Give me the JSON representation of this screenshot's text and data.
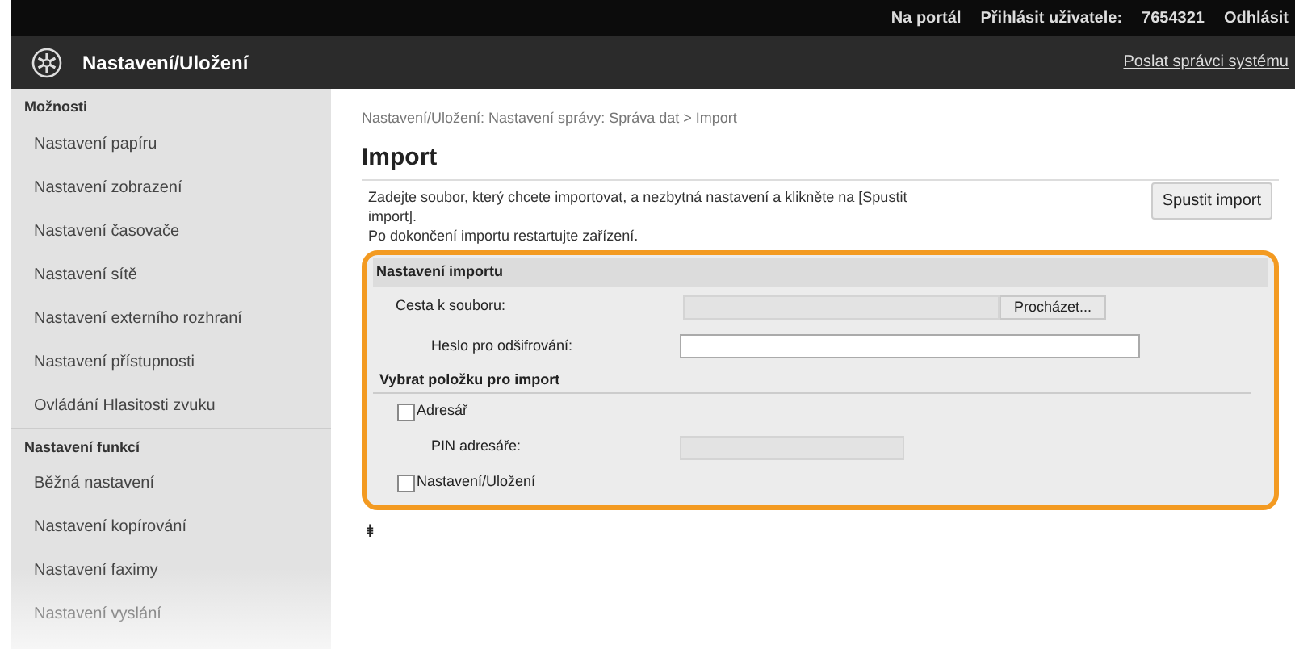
{
  "top_bar": {
    "links": [
      "Na portál",
      "Přihlásit uživatele:",
      "7654321",
      "Odhlásit"
    ]
  },
  "header": {
    "title": "Nastavení/Uložení",
    "link": "Poslat správci systému"
  },
  "sidebar": {
    "sections": [
      {
        "heading": "Možnosti",
        "items": [
          "Nastavení papíru",
          "Nastavení zobrazení",
          "Nastavení časovače",
          "Nastavení sítě",
          "Nastavení externího rozhraní",
          "Nastavení přístupnosti",
          "Ovládání Hlasitosti zvuku"
        ]
      },
      {
        "heading": "Nastavení funkcí",
        "items": [
          "Běžná nastavení",
          "Nastavení kopírování",
          "Nastavení faximy",
          "Nastavení vyslání"
        ]
      }
    ]
  },
  "breadcrumb": "Nastavení/Uložení: Nastavení správy: Správa dat > Import",
  "page_title": "Import",
  "instructions": [
    "Zadejte soubor, který chcete importovat, a nezbytná nastavení a klikněte na [Spustit import].",
    "Po dokončení importu restartujte zařízení."
  ],
  "start_button": "Spustit import",
  "import_settings": {
    "heading": "Nastavení importu",
    "file_path": {
      "label": "Cesta k souboru:",
      "browse": "Procházet..."
    },
    "password": {
      "label": "Heslo pro odšifrování:"
    },
    "select_heading": "Vybrat položku pro import",
    "items": [
      {
        "kind": "checkbox",
        "label": "Adresář",
        "checked": false
      },
      {
        "kind": "field",
        "label": "PIN adresáře:",
        "disabled": true
      },
      {
        "kind": "checkbox",
        "label": "Nastavení/Uložení",
        "checked": false
      }
    ]
  },
  "top_link": "⯒"
}
